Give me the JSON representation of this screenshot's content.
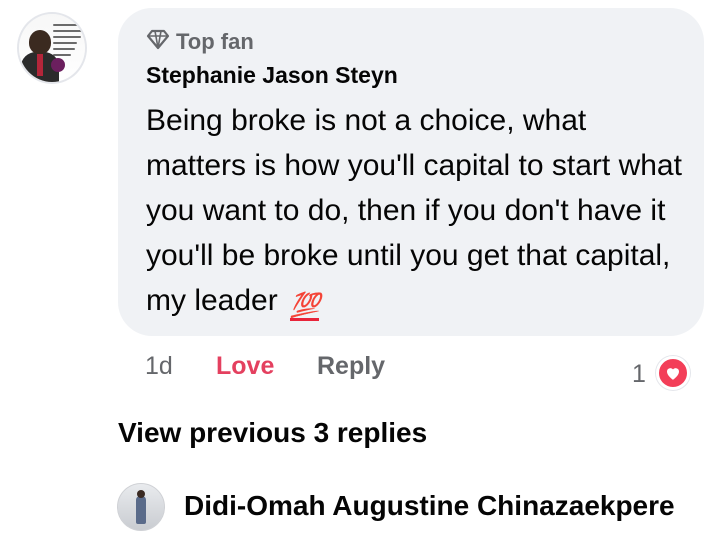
{
  "comment": {
    "badge_label": "Top fan",
    "author": "Stephanie Jason Steyn",
    "text": "Being broke is not a choice, what matters is how you'll capital to start what you want to do, then if you don't have it you'll be broke until you get that capital,  my leader",
    "emoji": "💯",
    "time": "1d",
    "reaction_label": "Love",
    "reply_label": "Reply",
    "reaction_count": "1",
    "reaction_icon": "love-reaction-icon",
    "avatar": "profile-photo"
  },
  "view_previous_label": "View previous 3 replies",
  "next_comment": {
    "author": "Didi-Omah Augustine Chinazaekpere",
    "avatar": "profile-photo"
  },
  "colors": {
    "bubble": "#f0f2f5",
    "love": "#e4405f",
    "secondary_text": "#65676b",
    "primary_text": "#050505",
    "reaction_badge": "#f33e58"
  }
}
